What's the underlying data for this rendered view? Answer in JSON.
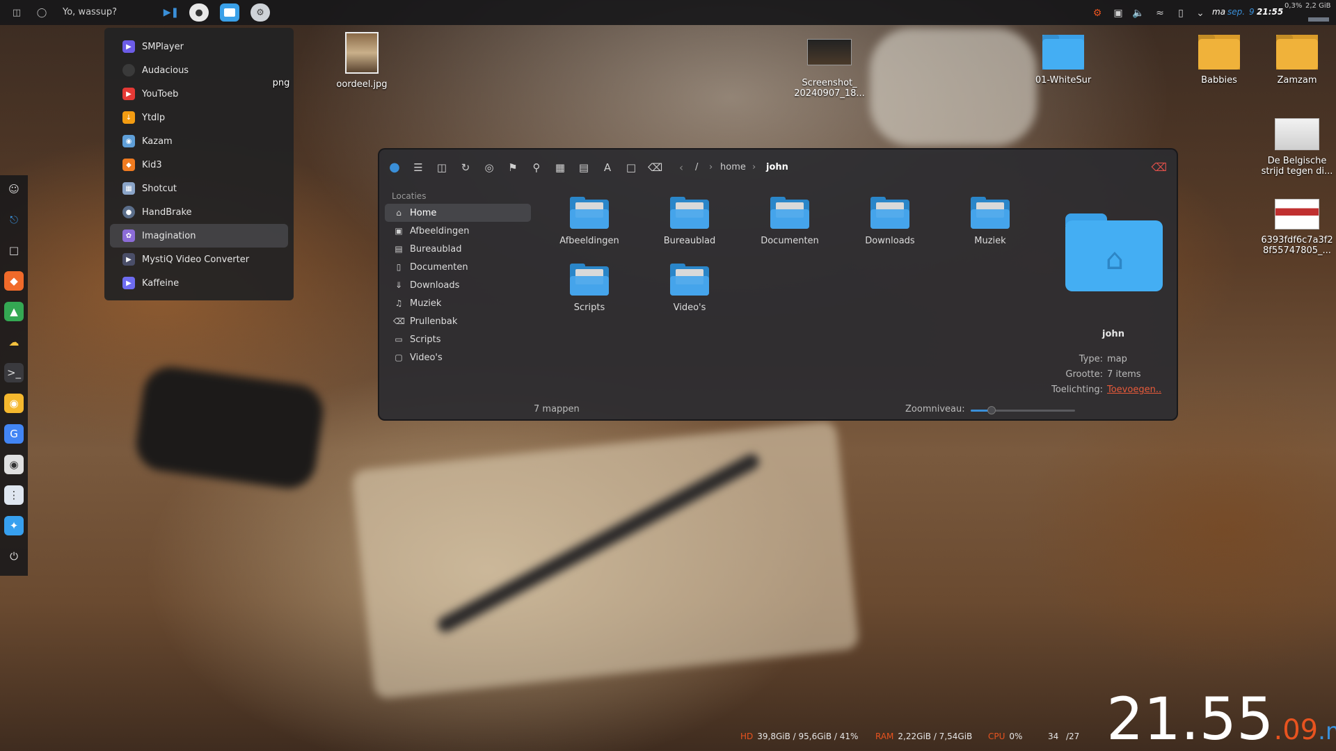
{
  "top_panel": {
    "title": "Yo, wassup?",
    "date": "ma",
    "date_month": "sep.",
    "date_day": "9",
    "time": "21:55",
    "cpu_mini": "0,3%",
    "ram_mini": "2,2 GiB"
  },
  "app_menu": {
    "items": [
      {
        "label": "SMPlayer",
        "color": "#6c5ce7"
      },
      {
        "label": "Audacious",
        "color": "#3a3a3a"
      },
      {
        "label": "YouToeb",
        "color": "#e53935"
      },
      {
        "label": "Ytdlp",
        "color": "#f39c12"
      },
      {
        "label": "Kazam",
        "color": "#5f9fd8"
      },
      {
        "label": "Kid3",
        "color": "#f07b20"
      },
      {
        "label": "Shotcut",
        "color": "#8aa4c8"
      },
      {
        "label": "HandBrake",
        "color": "#5b6e8a"
      },
      {
        "label": "Imagination",
        "color": "#8c6cd8"
      },
      {
        "label": "MystiQ Video Converter",
        "color": "#4a4e68"
      },
      {
        "label": "Kaffeine",
        "color": "#6e6cf0"
      }
    ]
  },
  "desktop_icons": [
    {
      "label": "png"
    },
    {
      "label": "oordeel.jpg"
    },
    {
      "label": "Screenshot_ 20240907_18..."
    },
    {
      "label": "01-WhiteSur"
    },
    {
      "label": "Babbies"
    },
    {
      "label": "Zamzam"
    },
    {
      "label": "De Belgische strijd tegen di..."
    },
    {
      "label": "6393fdf6c7a3f2 8f55747805_..."
    }
  ],
  "file_manager": {
    "breadcrumb": {
      "root": "/",
      "parent": "home",
      "current": "john"
    },
    "sidebar_header": "Locaties",
    "sidebar_items": [
      {
        "label": "Home",
        "icon": "home-icon"
      },
      {
        "label": "Afbeeldingen",
        "icon": "image-icon"
      },
      {
        "label": "Bureaublad",
        "icon": "desktop-icon"
      },
      {
        "label": "Documenten",
        "icon": "document-icon"
      },
      {
        "label": "Downloads",
        "icon": "download-icon"
      },
      {
        "label": "Muziek",
        "icon": "music-icon"
      },
      {
        "label": "Prullenbak",
        "icon": "trash-icon"
      },
      {
        "label": "Scripts",
        "icon": "folder-icon"
      },
      {
        "label": "Video's",
        "icon": "video-icon"
      }
    ],
    "folders": [
      {
        "label": "Afbeeldingen"
      },
      {
        "label": "Bureaublad"
      },
      {
        "label": "Documenten"
      },
      {
        "label": "Downloads"
      },
      {
        "label": "Muziek"
      },
      {
        "label": "Scripts"
      },
      {
        "label": "Video's"
      }
    ],
    "info": {
      "name": "john",
      "type_label": "Type:",
      "type_value": "map",
      "size_label": "Grootte:",
      "size_value": "7 items",
      "note_label": "Toelichting:",
      "note_value": "Toevoegen.."
    },
    "status": "7 mappen",
    "zoom_label": "Zoomniveau:",
    "zoom_level": 0.2
  },
  "bottom_stats": {
    "hd_label": "HD",
    "hd_value": "39,8GiB / 95,6GiB / 41%",
    "ram_label": "RAM",
    "ram_value": "2,22GiB / 7,54GiB",
    "cpu_label": "CPU",
    "cpu_value": "0%",
    "temp_value": "34",
    "temp2_value": "/27"
  },
  "big_clock": {
    "hours": "21",
    "minutes": "55",
    "seconds": "09",
    "day": "ma"
  },
  "colors": {
    "accent": "#3a8fd8",
    "orange": "#e8531f",
    "folder_blue": "#44aef3"
  }
}
